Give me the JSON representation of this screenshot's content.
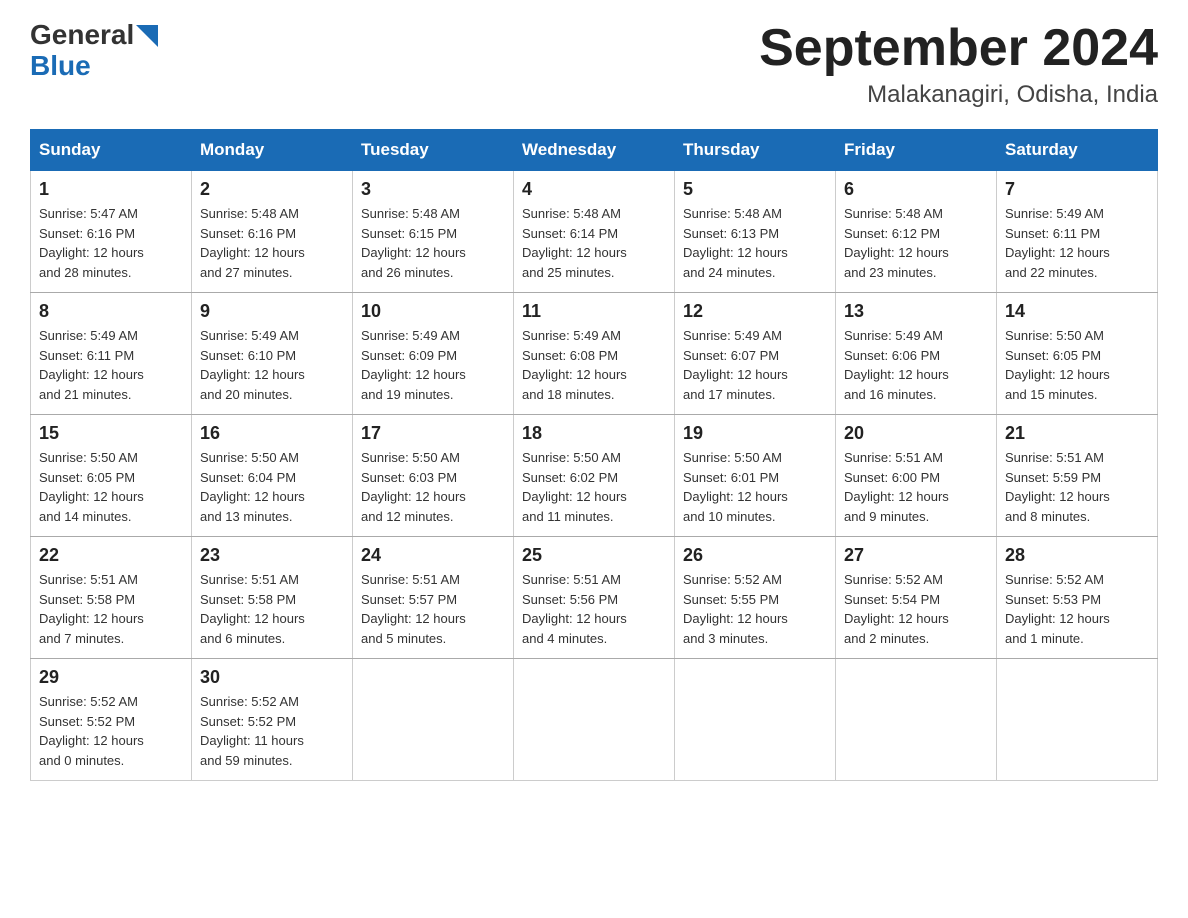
{
  "header": {
    "logo_general": "General",
    "logo_blue": "Blue",
    "title": "September 2024",
    "subtitle": "Malakanagiri, Odisha, India"
  },
  "weekdays": [
    "Sunday",
    "Monday",
    "Tuesday",
    "Wednesday",
    "Thursday",
    "Friday",
    "Saturday"
  ],
  "weeks": [
    [
      {
        "day": "1",
        "sunrise": "5:47 AM",
        "sunset": "6:16 PM",
        "daylight": "12 hours and 28 minutes."
      },
      {
        "day": "2",
        "sunrise": "5:48 AM",
        "sunset": "6:16 PM",
        "daylight": "12 hours and 27 minutes."
      },
      {
        "day": "3",
        "sunrise": "5:48 AM",
        "sunset": "6:15 PM",
        "daylight": "12 hours and 26 minutes."
      },
      {
        "day": "4",
        "sunrise": "5:48 AM",
        "sunset": "6:14 PM",
        "daylight": "12 hours and 25 minutes."
      },
      {
        "day": "5",
        "sunrise": "5:48 AM",
        "sunset": "6:13 PM",
        "daylight": "12 hours and 24 minutes."
      },
      {
        "day": "6",
        "sunrise": "5:48 AM",
        "sunset": "6:12 PM",
        "daylight": "12 hours and 23 minutes."
      },
      {
        "day": "7",
        "sunrise": "5:49 AM",
        "sunset": "6:11 PM",
        "daylight": "12 hours and 22 minutes."
      }
    ],
    [
      {
        "day": "8",
        "sunrise": "5:49 AM",
        "sunset": "6:11 PM",
        "daylight": "12 hours and 21 minutes."
      },
      {
        "day": "9",
        "sunrise": "5:49 AM",
        "sunset": "6:10 PM",
        "daylight": "12 hours and 20 minutes."
      },
      {
        "day": "10",
        "sunrise": "5:49 AM",
        "sunset": "6:09 PM",
        "daylight": "12 hours and 19 minutes."
      },
      {
        "day": "11",
        "sunrise": "5:49 AM",
        "sunset": "6:08 PM",
        "daylight": "12 hours and 18 minutes."
      },
      {
        "day": "12",
        "sunrise": "5:49 AM",
        "sunset": "6:07 PM",
        "daylight": "12 hours and 17 minutes."
      },
      {
        "day": "13",
        "sunrise": "5:49 AM",
        "sunset": "6:06 PM",
        "daylight": "12 hours and 16 minutes."
      },
      {
        "day": "14",
        "sunrise": "5:50 AM",
        "sunset": "6:05 PM",
        "daylight": "12 hours and 15 minutes."
      }
    ],
    [
      {
        "day": "15",
        "sunrise": "5:50 AM",
        "sunset": "6:05 PM",
        "daylight": "12 hours and 14 minutes."
      },
      {
        "day": "16",
        "sunrise": "5:50 AM",
        "sunset": "6:04 PM",
        "daylight": "12 hours and 13 minutes."
      },
      {
        "day": "17",
        "sunrise": "5:50 AM",
        "sunset": "6:03 PM",
        "daylight": "12 hours and 12 minutes."
      },
      {
        "day": "18",
        "sunrise": "5:50 AM",
        "sunset": "6:02 PM",
        "daylight": "12 hours and 11 minutes."
      },
      {
        "day": "19",
        "sunrise": "5:50 AM",
        "sunset": "6:01 PM",
        "daylight": "12 hours and 10 minutes."
      },
      {
        "day": "20",
        "sunrise": "5:51 AM",
        "sunset": "6:00 PM",
        "daylight": "12 hours and 9 minutes."
      },
      {
        "day": "21",
        "sunrise": "5:51 AM",
        "sunset": "5:59 PM",
        "daylight": "12 hours and 8 minutes."
      }
    ],
    [
      {
        "day": "22",
        "sunrise": "5:51 AM",
        "sunset": "5:58 PM",
        "daylight": "12 hours and 7 minutes."
      },
      {
        "day": "23",
        "sunrise": "5:51 AM",
        "sunset": "5:58 PM",
        "daylight": "12 hours and 6 minutes."
      },
      {
        "day": "24",
        "sunrise": "5:51 AM",
        "sunset": "5:57 PM",
        "daylight": "12 hours and 5 minutes."
      },
      {
        "day": "25",
        "sunrise": "5:51 AM",
        "sunset": "5:56 PM",
        "daylight": "12 hours and 4 minutes."
      },
      {
        "day": "26",
        "sunrise": "5:52 AM",
        "sunset": "5:55 PM",
        "daylight": "12 hours and 3 minutes."
      },
      {
        "day": "27",
        "sunrise": "5:52 AM",
        "sunset": "5:54 PM",
        "daylight": "12 hours and 2 minutes."
      },
      {
        "day": "28",
        "sunrise": "5:52 AM",
        "sunset": "5:53 PM",
        "daylight": "12 hours and 1 minute."
      }
    ],
    [
      {
        "day": "29",
        "sunrise": "5:52 AM",
        "sunset": "5:52 PM",
        "daylight": "12 hours and 0 minutes."
      },
      {
        "day": "30",
        "sunrise": "5:52 AM",
        "sunset": "5:52 PM",
        "daylight": "11 hours and 59 minutes."
      },
      null,
      null,
      null,
      null,
      null
    ]
  ],
  "labels": {
    "sunrise": "Sunrise:",
    "sunset": "Sunset:",
    "daylight": "Daylight:"
  }
}
